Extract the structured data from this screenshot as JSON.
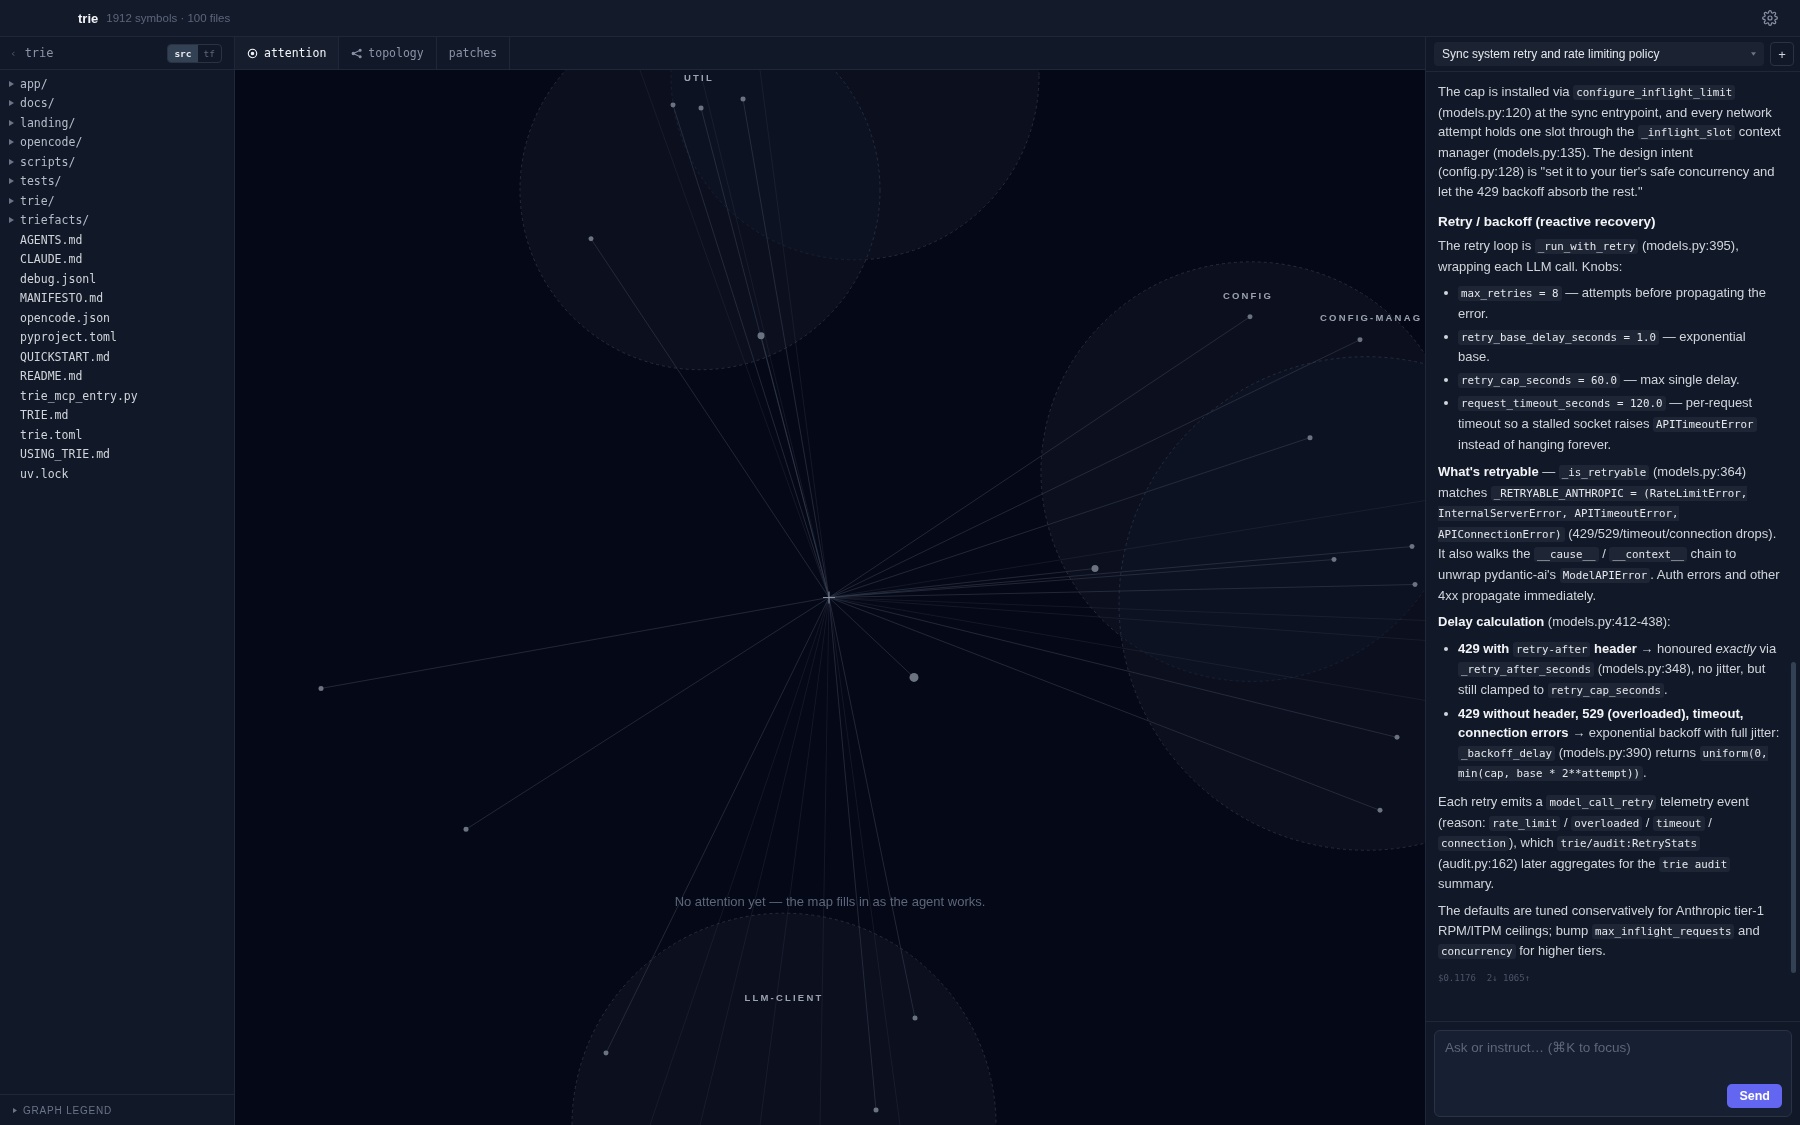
{
  "top_bar": {
    "project": "trie",
    "stats": "1912 symbols · 100 files"
  },
  "sidebar": {
    "back": "‹",
    "title": "trie",
    "modes": [
      {
        "label": "src",
        "selected": true
      },
      {
        "label": "tf",
        "selected": false
      }
    ],
    "items": [
      {
        "kind": "folder",
        "name": "app/",
        "expanded": false
      },
      {
        "kind": "folder",
        "name": "docs/",
        "expanded": false
      },
      {
        "kind": "folder",
        "name": "landing/",
        "expanded": false
      },
      {
        "kind": "folder",
        "name": "opencode/",
        "expanded": false
      },
      {
        "kind": "folder",
        "name": "scripts/",
        "expanded": false
      },
      {
        "kind": "folder",
        "name": "tests/",
        "expanded": false
      },
      {
        "kind": "folder",
        "name": "trie/",
        "expanded": false
      },
      {
        "kind": "folder",
        "name": "triefacts/",
        "expanded": false
      },
      {
        "kind": "file",
        "name": "AGENTS.md"
      },
      {
        "kind": "file",
        "name": "CLAUDE.md"
      },
      {
        "kind": "file",
        "name": "debug.jsonl"
      },
      {
        "kind": "file",
        "name": "MANIFESTO.md"
      },
      {
        "kind": "file",
        "name": "opencode.json"
      },
      {
        "kind": "file",
        "name": "pyproject.toml"
      },
      {
        "kind": "file",
        "name": "QUICKSTART.md"
      },
      {
        "kind": "file",
        "name": "README.md"
      },
      {
        "kind": "file",
        "name": "trie_mcp_entry.py"
      },
      {
        "kind": "file",
        "name": "TRIE.md"
      },
      {
        "kind": "file",
        "name": "trie.toml"
      },
      {
        "kind": "file",
        "name": "USING_TRIE.md"
      },
      {
        "kind": "file",
        "name": "uv.lock"
      }
    ],
    "legend": {
      "label": "GRAPH LEGEND",
      "expanded": false
    }
  },
  "tabs": [
    {
      "label": "attention",
      "kind": "target",
      "selected": true
    },
    {
      "label": "topology",
      "kind": "share",
      "selected": false
    },
    {
      "label": "patches",
      "kind": "plain",
      "selected": false
    }
  ],
  "graph": {
    "clusters": [
      {
        "label": "UTIL"
      },
      {
        "label": "CONFIG"
      },
      {
        "label": "CONFIG-MANAG"
      },
      {
        "label": "LLM-CLIENT"
      }
    ],
    "empty_message": "No attention yet — the map fills in as the agent works."
  },
  "chat": {
    "session": "Sync system retry and rate limiting policy",
    "new_button": "+",
    "blocks": [
      {
        "kind": "paragraph",
        "segments": [
          {
            "kind": "text",
            "text": "The cap is installed via "
          },
          {
            "kind": "code",
            "text": "configure_inflight_limit"
          },
          {
            "kind": "text",
            "text": " (models.py:120) at the sync entrypoint, and every network attempt holds one slot through the "
          },
          {
            "kind": "code",
            "text": "_inflight_slot"
          },
          {
            "kind": "text",
            "text": " context manager (models.py:135). The design intent (config.py:128) is \"set it to your tier's safe concurrency and let the 429 backoff absorb the rest.\""
          }
        ]
      },
      {
        "kind": "heading",
        "text": "Retry / backoff (reactive recovery)"
      },
      {
        "kind": "paragraph",
        "segments": [
          {
            "kind": "text",
            "text": "The retry loop is "
          },
          {
            "kind": "code",
            "text": "_run_with_retry"
          },
          {
            "kind": "text",
            "text": " (models.py:395), wrapping each LLM call. Knobs:"
          }
        ]
      },
      {
        "kind": "list",
        "items": [
          {
            "segments": [
              {
                "kind": "code",
                "text": "max_retries = 8"
              },
              {
                "kind": "text",
                "text": " — attempts before propagating the error."
              }
            ]
          },
          {
            "segments": [
              {
                "kind": "code",
                "text": "retry_base_delay_seconds = 1.0"
              },
              {
                "kind": "text",
                "text": " — exponential base."
              }
            ]
          },
          {
            "segments": [
              {
                "kind": "code",
                "text": "retry_cap_seconds = 60.0"
              },
              {
                "kind": "text",
                "text": " — max single delay."
              }
            ]
          },
          {
            "segments": [
              {
                "kind": "code",
                "text": "request_timeout_seconds = 120.0"
              },
              {
                "kind": "text",
                "text": " — per-request timeout so a stalled socket raises "
              },
              {
                "kind": "code",
                "text": "APITimeoutError"
              },
              {
                "kind": "text",
                "text": " instead of hanging forever."
              }
            ]
          }
        ]
      },
      {
        "kind": "paragraph",
        "segments": [
          {
            "kind": "text",
            "text": "**What's retryable** — "
          },
          {
            "kind": "code",
            "text": "_is_retryable"
          },
          {
            "kind": "text",
            "text": " (models.py:364) matches "
          },
          {
            "kind": "code",
            "text": "_RETRYABLE_ANTHROPIC = (RateLimitError, InternalServerError, APITimeoutError, APIConnectionError)"
          },
          {
            "kind": "text",
            "text": " (429/529/timeout/connection drops). It also walks the "
          },
          {
            "kind": "code",
            "text": "__cause__"
          },
          {
            "kind": "text",
            "text": " / "
          },
          {
            "kind": "code",
            "text": "__context__"
          },
          {
            "kind": "text",
            "text": " chain to unwrap pydantic-ai's "
          },
          {
            "kind": "code",
            "text": "ModelAPIError"
          },
          {
            "kind": "text",
            "text": ". Auth errors and other 4xx propagate immediately."
          }
        ]
      },
      {
        "kind": "paragraph",
        "segments": [
          {
            "kind": "text",
            "text": "**Delay calculation** (models.py:412-438):"
          }
        ]
      },
      {
        "kind": "list",
        "items": [
          {
            "segments": [
              {
                "kind": "text",
                "text": "**429 with** "
              },
              {
                "kind": "code",
                "text": "retry-after"
              },
              {
                "kind": "text",
                "text": " **header** → honoured *exactly* via "
              },
              {
                "kind": "code",
                "text": "_retry_after_seconds"
              },
              {
                "kind": "text",
                "text": " (models.py:348), no jitter, but still clamped to "
              },
              {
                "kind": "code",
                "text": "retry_cap_seconds"
              },
              {
                "kind": "text",
                "text": "."
              }
            ]
          },
          {
            "segments": [
              {
                "kind": "text",
                "text": "**429 without header, 529 (overloaded), timeout, connection errors** → exponential backoff with full jitter: "
              },
              {
                "kind": "code",
                "text": "_backoff_delay"
              },
              {
                "kind": "text",
                "text": " (models.py:390) returns "
              },
              {
                "kind": "code",
                "text": "uniform(0, min(cap, base * 2**attempt))"
              },
              {
                "kind": "text",
                "text": "."
              }
            ]
          }
        ]
      },
      {
        "kind": "paragraph",
        "segments": [
          {
            "kind": "text",
            "text": "Each retry emits a "
          },
          {
            "kind": "code",
            "text": "model_call_retry"
          },
          {
            "kind": "text",
            "text": " telemetry event (reason: "
          },
          {
            "kind": "code",
            "text": "rate_limit"
          },
          {
            "kind": "text",
            "text": " / "
          },
          {
            "kind": "code",
            "text": "overloaded"
          },
          {
            "kind": "text",
            "text": " / "
          },
          {
            "kind": "code",
            "text": "timeout"
          },
          {
            "kind": "text",
            "text": " / "
          },
          {
            "kind": "code",
            "text": "connection"
          },
          {
            "kind": "text",
            "text": "), which "
          },
          {
            "kind": "code",
            "text": "trie/audit:RetryStats"
          },
          {
            "kind": "text",
            "text": " (audit.py:162) later aggregates for the "
          },
          {
            "kind": "code",
            "text": "trie audit"
          },
          {
            "kind": "text",
            "text": " summary."
          }
        ]
      },
      {
        "kind": "paragraph",
        "segments": [
          {
            "kind": "text",
            "text": "The defaults are tuned conservatively for Anthropic tier-1 RPM/ITPM ceilings; bump "
          },
          {
            "kind": "code",
            "text": "max_inflight_requests"
          },
          {
            "kind": "text",
            "text": " and "
          },
          {
            "kind": "code",
            "text": "concurrency"
          },
          {
            "kind": "text",
            "text": " for higher tiers."
          }
        ]
      }
    ],
    "meta": "$0.1176  2↓ 1065↑",
    "input": {
      "placeholder": "Ask or instruct… (⌘K to focus)"
    },
    "send_button": "Send"
  }
}
